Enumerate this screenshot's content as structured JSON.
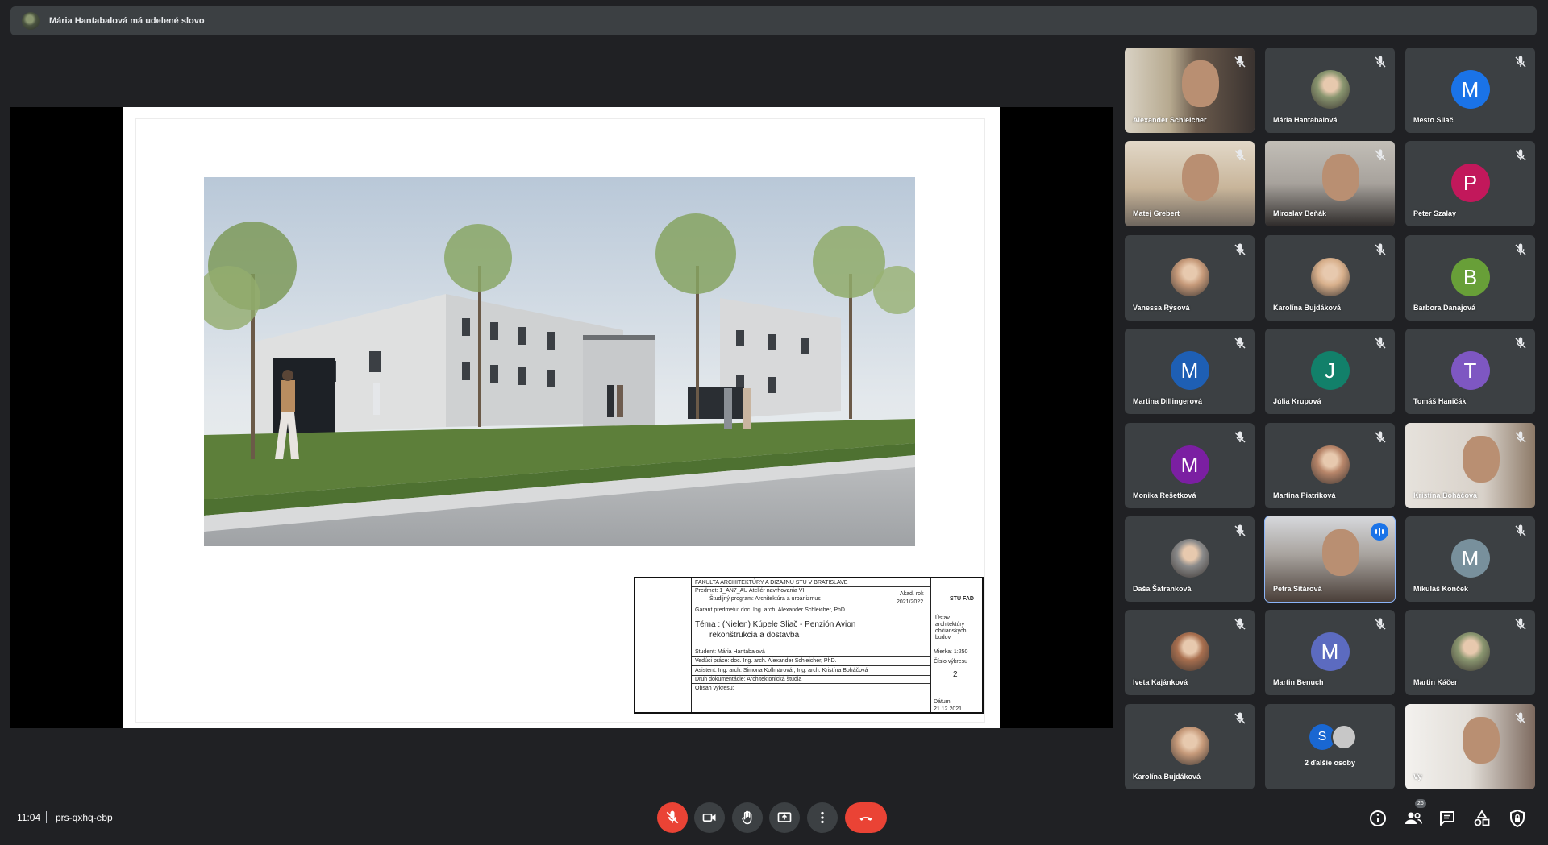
{
  "banner": {
    "text": "Mária Hantabalová má udelené slovo"
  },
  "titleblock": {
    "faculty": "FAKULTA ARCHITEKTÚRY A DIZAJNU STU V BRATISLAVE",
    "subject": "Predmet: 1_AN7_AU Ateliér navrhovania VII",
    "program": "Študijný program: Architektúra a urbanizmus",
    "year_label": "Akad. rok",
    "year": "2021/2022",
    "guarantor": "Garant predmetu: doc. Ing. arch. Alexander Schleicher, PhD.",
    "theme": "Téma : (Nielen) Kúpele Sliač - Penzión Avion",
    "theme2": "rekonštrukcia a dostavba",
    "student": "Študent: Mária Hantabalová",
    "supervisor": "Vedúci práce: doc. Ing. arch. Alexander Schleicher, PhD.",
    "assistant": "Asistent: Ing. arch. Simona Kollmárová , Ing. arch. Kristína Boháčová",
    "doctype": "Druh dokumentácie:   Architektonická štúdia",
    "content": "Obsah výkresu:",
    "logo": "STU FAD",
    "institute": "Ústav architektúry občianskych budov",
    "scale": "Mierka: 1:250",
    "drawing_no_label": "Číslo výkresu",
    "drawing_no": "2",
    "date_label": "Dátum",
    "date": "21.12.2021"
  },
  "participants": [
    {
      "name": "Alexander Schleicher",
      "kind": "video",
      "muted": true
    },
    {
      "name": "Mária Hantabalová",
      "kind": "photo",
      "muted": true
    },
    {
      "name": "Mesto Sliač",
      "kind": "letter",
      "letter": "M",
      "color": "#1a73e8",
      "muted": true
    },
    {
      "name": "Matej Grebert",
      "kind": "video",
      "muted": true
    },
    {
      "name": "Miroslav Beňák",
      "kind": "video",
      "muted": true
    },
    {
      "name": "Peter Szalay",
      "kind": "letter",
      "letter": "P",
      "color": "#c2185b",
      "muted": true
    },
    {
      "name": "Vanessa Rýsová",
      "kind": "photo",
      "muted": true
    },
    {
      "name": "Karolína Bujdáková",
      "kind": "photo",
      "muted": true
    },
    {
      "name": "Barbora Danajová",
      "kind": "letter",
      "letter": "B",
      "color": "#689f38",
      "muted": true
    },
    {
      "name": "Martina Dillingerová",
      "kind": "letter",
      "letter": "M",
      "color": "#1e5fb4",
      "muted": true
    },
    {
      "name": "Júlia Krupová",
      "kind": "letter",
      "letter": "J",
      "color": "#12806a",
      "muted": true
    },
    {
      "name": "Tomáš Haničák",
      "kind": "letter",
      "letter": "T",
      "color": "#7e57c2",
      "muted": true
    },
    {
      "name": "Monika Rešetková",
      "kind": "letter",
      "letter": "M",
      "color": "#7b1fa2",
      "muted": true
    },
    {
      "name": "Martina Piatriková",
      "kind": "photo",
      "muted": true
    },
    {
      "name": "Kristína Boháčová",
      "kind": "video",
      "muted": true
    },
    {
      "name": "Daša Šafranková",
      "kind": "photo",
      "muted": true
    },
    {
      "name": "Petra Sitárová",
      "kind": "video",
      "muted": false,
      "speaking": true
    },
    {
      "name": "Mikuláš Konček",
      "kind": "letter",
      "letter": "M",
      "color": "#78909c",
      "muted": true
    },
    {
      "name": "Iveta Kajánková",
      "kind": "photo",
      "muted": true
    },
    {
      "name": "Martin Benuch",
      "kind": "letter",
      "letter": "M",
      "color": "#5c6bc0",
      "muted": true
    },
    {
      "name": "Martin Káčer",
      "kind": "photo",
      "muted": true
    },
    {
      "name": "Karolína Bujdáková",
      "kind": "photo",
      "muted": true
    },
    {
      "name": "2 ďalšie osoby",
      "kind": "more",
      "letter": "S",
      "muted": false
    },
    {
      "name": "Vy",
      "kind": "video",
      "muted": true
    }
  ],
  "bottombar": {
    "time": "11:04",
    "meeting_code": "prs-qxhq-ebp",
    "people_count": "26",
    "controls": [
      "mic-off-icon",
      "camera-icon",
      "raise-hand-icon",
      "present-icon",
      "more-options-icon",
      "hang-up-icon"
    ],
    "side": [
      "info-icon",
      "people-icon",
      "chat-icon",
      "activities-icon",
      "host-controls-icon"
    ]
  }
}
